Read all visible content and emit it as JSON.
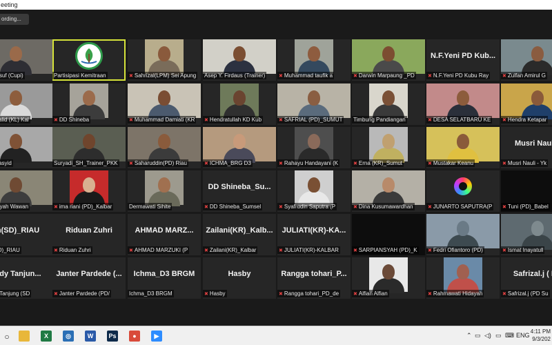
{
  "window": {
    "title": "eeting"
  },
  "recording": {
    "label": "ording..."
  },
  "tiles": [
    {
      "label": "mad Yusuf (Cupi)",
      "muted": false,
      "type": "video",
      "bg": "#6d6a64",
      "skin": "#9a6a4a",
      "shirt": "#2e2e34"
    },
    {
      "label": "Partisipasi Kemitraan",
      "muted": false,
      "type": "logo",
      "bg": "#111111",
      "active": true
    },
    {
      "label": "Sahrizal(LPM) Sei Apung",
      "muted": true,
      "type": "video",
      "bg": "#b8ad8c",
      "skin": "#8a5a3c",
      "shirt": "#7a6c5a",
      "narrow": true
    },
    {
      "label": "Asep Y. Firdaus (Trainer)",
      "muted": false,
      "type": "video",
      "bg": "#d2d0c8",
      "skin": "#7b4e32",
      "shirt": "#2c3140"
    },
    {
      "label": "Muhammad taufik a",
      "muted": true,
      "type": "video",
      "bg": "#9fa39a",
      "skin": "#8e5c3f",
      "shirt": "#34495e",
      "narrow": true
    },
    {
      "label": "Darwin Marpaung _PD",
      "muted": true,
      "type": "video",
      "bg": "#8aa85c",
      "skin": "#7c4d31",
      "shirt": "#4a4a4a"
    },
    {
      "label": "N.F.Yeni PD Kubu Ray",
      "muted": true,
      "type": "name",
      "name": "N.F.Yeni PD Kub..."
    },
    {
      "label": "Zulfan Amirul G",
      "muted": true,
      "type": "video",
      "bg": "#7a8a8e",
      "skin": "#8a5c40",
      "shirt": "#2a2a2a"
    },
    {
      "label": "ul Khalid (KL) Kal",
      "muted": true,
      "type": "video",
      "bg": "#9a9a9a",
      "skin": "#8d5d3d",
      "shirt": "#dadada"
    },
    {
      "label": "DD Shineba",
      "muted": true,
      "type": "video",
      "bg": "#a6a39a",
      "skin": "#9b6b4b",
      "shirt": "#3c3c3c",
      "narrow": true
    },
    {
      "label": "Muhammad Damiati (KR",
      "muted": true,
      "type": "video",
      "bg": "#c9c3b6",
      "skin": "#7a4d33",
      "shirt": "#4b5a6e"
    },
    {
      "label": "Hendratullah KD Kub",
      "muted": true,
      "type": "video",
      "bg": "#6e7a5a",
      "skin": "#6a4430",
      "shirt": "#2f2f2f",
      "narrow": true
    },
    {
      "label": "SAFRIAL (PD)_SUMUT",
      "muted": true,
      "type": "video",
      "bg": "#b8b3a6",
      "skin": "#8a5e42",
      "shirt": "#5a6b7c"
    },
    {
      "label": "Timbung Pandiangan",
      "muted": false,
      "type": "video",
      "bg": "#d9d6cc",
      "skin": "#7a5036",
      "shirt": "#3a3a3a",
      "narrow": true
    },
    {
      "label": "DESA SELATBARU KE",
      "muted": true,
      "type": "video",
      "bg": "#c28a8a",
      "skin": "#8c5c3c",
      "shirt": "#2a2f3a"
    },
    {
      "label": "Hendra Ketapar",
      "muted": true,
      "type": "video",
      "bg": "#c9a54a",
      "skin": "#8a5a3a",
      "shirt": "#1f3f6a"
    },
    {
      "label": "lim Rasyid",
      "muted": true,
      "type": "video",
      "bg": "#a8a8a8",
      "skin": "#7f5236",
      "shirt": "#222222"
    },
    {
      "label": "Suryadi_SH_Trainer_PKK",
      "muted": false,
      "type": "video",
      "bg": "#5a5e52",
      "skin": "#6f452d",
      "shirt": "#2d2d2d"
    },
    {
      "label": "Saharuddin(PD) Riau",
      "muted": true,
      "type": "video",
      "bg": "#7d7468",
      "skin": "#8a5b3c",
      "shirt": "#3b3b3b"
    },
    {
      "label": "ICHMA_BRG D3",
      "muted": true,
      "type": "video",
      "bg": "#b59a7e",
      "skin": "#c89a7a",
      "shirt": "#4a4a5a"
    },
    {
      "label": "Rahayu Handayani (K",
      "muted": true,
      "type": "video",
      "bg": "#4e4e4e",
      "skin": "#8a6a5a",
      "shirt": "#2a2a2a",
      "narrow": true
    },
    {
      "label": "Erna (KR)_Sumut",
      "muted": true,
      "type": "video",
      "bg": "#b9b9b9",
      "skin": "#c0a070",
      "shirt": "#c0b060",
      "narrow": true
    },
    {
      "label": "Mustakar Keanu",
      "muted": true,
      "type": "video",
      "bg": "#d6c15a",
      "skin": "#8a5a3a",
      "shirt": "#e0c040"
    },
    {
      "label": "Musri Nauli - Yk",
      "muted": true,
      "type": "name",
      "name": "Musri Nauli -"
    },
    {
      "label": "nawansyah Wawan",
      "muted": false,
      "type": "video",
      "bg": "#8a8676",
      "skin": "#6f4a33",
      "shirt": "#3d3d3d"
    },
    {
      "label": "ima riani (PD)_Kalbar",
      "muted": true,
      "type": "video",
      "bg": "#c62b2b",
      "skin": "#d8b090",
      "shirt": "#1a1a1a",
      "narrow": true
    },
    {
      "label": "Dermawati Sihite",
      "muted": false,
      "type": "video",
      "bg": "#9d9a8e",
      "skin": "#a07050",
      "shirt": "#6a6a5a",
      "narrow": true
    },
    {
      "label": "DD Shineba_Sumsel",
      "muted": true,
      "type": "name",
      "name": "DD Shineba_Su..."
    },
    {
      "label": "Syafrudin Saputra (P",
      "muted": true,
      "type": "video",
      "bg": "#cfcfcf",
      "skin": "#7a5034",
      "shirt": "#e8e8e8",
      "narrow": true
    },
    {
      "label": "Dina Kusumawardhan",
      "muted": true,
      "type": "video",
      "bg": "#b4b0a6",
      "skin": "#b88a6a",
      "shirt": "#3a3a3a"
    },
    {
      "label": "JUNARTO SAPUTRA(P",
      "muted": true,
      "type": "camlogo"
    },
    {
      "label": "Tuni (PD)_Babel",
      "muted": true,
      "type": "dark"
    },
    {
      "label": "an(SD)_RIAU",
      "muted": true,
      "type": "name",
      "name": "an(SD)_RIAU"
    },
    {
      "label": "Riduan Zuhri",
      "muted": true,
      "type": "name",
      "name": "Riduan Zuhri"
    },
    {
      "label": "AHMAD MARZUKI (P",
      "muted": true,
      "type": "name",
      "name": "AHMAD  MARZ..."
    },
    {
      "label": "Zailani(KR)_Kalbar",
      "muted": true,
      "type": "name",
      "name": "Zailani(KR)_Kalb..."
    },
    {
      "label": "JULIATI(KR)-KALBAR",
      "muted": true,
      "type": "name",
      "name": "JULIATI(KR)-KA..."
    },
    {
      "label": "SARPIANSYAH (PD)_K",
      "muted": true,
      "type": "dark"
    },
    {
      "label": "Fedri Ofiantoro (PD)",
      "muted": true,
      "type": "video",
      "bg": "#8a9aa8",
      "skin": "#6a7a86",
      "shirt": "#3d4a50"
    },
    {
      "label": "Ismat Inayatull",
      "muted": true,
      "type": "video",
      "bg": "#5e6a70",
      "skin": "#7e8a8e",
      "shirt": "#3a4448"
    },
    {
      "label": "andy Tanjung (SD",
      "muted": true,
      "type": "name",
      "name": "andy  Tanjun..."
    },
    {
      "label": "Janter Pardede (PD/",
      "muted": true,
      "type": "name",
      "name": "Janter Pardede (..."
    },
    {
      "label": "Ichma_D3 BRGM",
      "muted": false,
      "type": "name",
      "name": "Ichma_D3 BRGM"
    },
    {
      "label": "Hasby",
      "muted": true,
      "type": "name",
      "name": "Hasby"
    },
    {
      "label": "Rangga tohari_PD_de",
      "muted": true,
      "type": "name",
      "name": "Rangga tohari_P..."
    },
    {
      "label": "Alfian Alfian",
      "muted": true,
      "type": "video",
      "bg": "#e8e8e8",
      "skin": "#6b4a38",
      "shirt": "#2a2a2a",
      "narrow": true
    },
    {
      "label": "Rahmawati Hidayah",
      "muted": true,
      "type": "video",
      "bg": "#6a8aa8",
      "skin": "#a06050",
      "shirt": "#c0504a",
      "narrow": true
    },
    {
      "label": "Safrizal.j (PD Su",
      "muted": true,
      "type": "name",
      "name": "Safrizal.j ( PD"
    }
  ],
  "taskbar": {
    "apps": [
      {
        "icon": "folder-icon",
        "color": "#e8b73a",
        "glyph": ""
      },
      {
        "icon": "excel-icon",
        "color": "#1f7a44",
        "glyph": "X"
      },
      {
        "icon": "search-app-icon",
        "color": "#2b6fb5",
        "glyph": "◎"
      },
      {
        "icon": "word-icon",
        "color": "#2a5aa8",
        "glyph": "W"
      },
      {
        "icon": "photoshop-icon",
        "color": "#0d2a4a",
        "glyph": "Ps"
      },
      {
        "icon": "chrome-icon",
        "color": "#d94a3a",
        "glyph": "●"
      },
      {
        "icon": "zoom-icon",
        "color": "#2d8cff",
        "glyph": "▶"
      }
    ],
    "language": "ENG",
    "time": "4:11 PM",
    "date": "9/3/202"
  }
}
